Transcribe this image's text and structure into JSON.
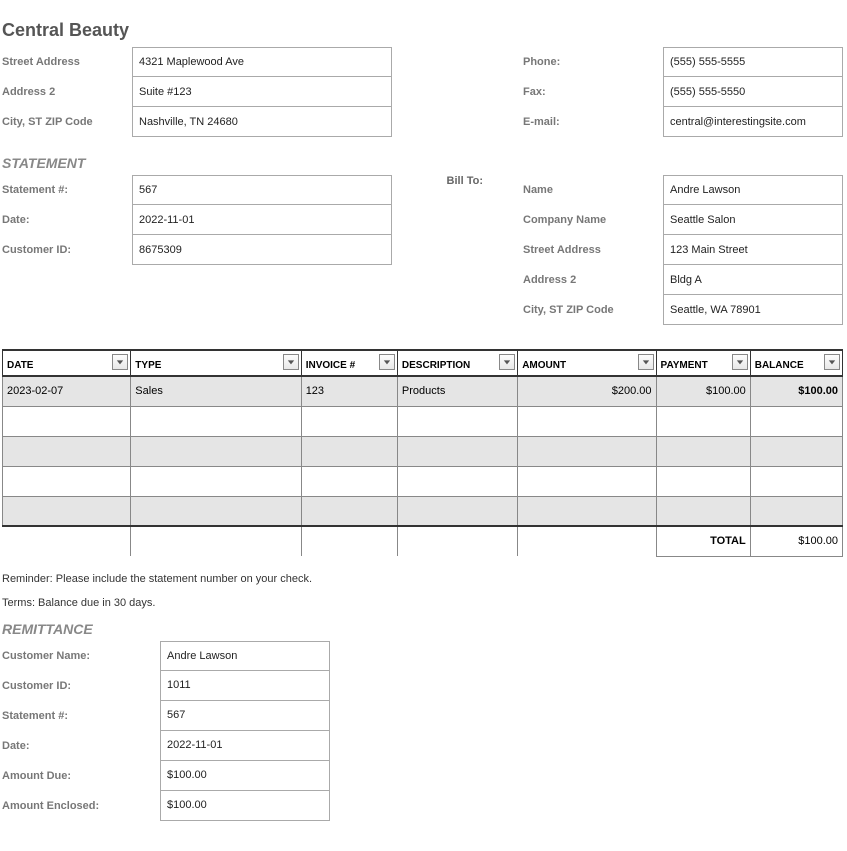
{
  "company_name": "Central Beauty",
  "address_labels": {
    "street": "Street Address",
    "address2": "Address 2",
    "city": "City, ST  ZIP Code"
  },
  "company_address": {
    "street": "4321 Maplewood Ave",
    "address2": "Suite #123",
    "city": "Nashville, TN 24680"
  },
  "contact_labels": {
    "phone": "Phone:",
    "fax": "Fax:",
    "email": "E-mail:"
  },
  "contact": {
    "phone": "(555) 555-5555",
    "fax": "(555) 555-5550",
    "email": "central@interestingsite.com"
  },
  "statement_heading": "STATEMENT",
  "statement_labels": {
    "number": "Statement #:",
    "date": "Date:",
    "customer_id": "Customer ID:"
  },
  "statement": {
    "number": "567",
    "date": "2022-11-01",
    "customer_id": "8675309"
  },
  "billto_heading": "Bill To:",
  "billto_labels": {
    "name": "Name",
    "company": "Company Name",
    "street": "Street Address",
    "address2": "Address 2",
    "city": "City, ST  ZIP Code"
  },
  "billto": {
    "name": "Andre Lawson",
    "company": "Seattle Salon",
    "street": "123 Main Street",
    "address2": "Bldg A",
    "city": "Seattle, WA 78901"
  },
  "columns": {
    "date": "DATE",
    "type": "TYPE",
    "invoice": "INVOICE #",
    "description": "DESCRIPTION",
    "amount": "AMOUNT",
    "payment": "PAYMENT",
    "balance": "BALANCE"
  },
  "rows": [
    {
      "date": "2023-02-07",
      "type": "Sales",
      "invoice": "123",
      "description": "Products",
      "amount": "$200.00",
      "payment": "$100.00",
      "balance": "$100.00"
    }
  ],
  "total_label": "TOTAL",
  "total_value": "$100.00",
  "reminder": "Reminder: Please include the statement number on your check.",
  "terms": "Terms: Balance due in 30 days.",
  "remittance_heading": "REMITTANCE",
  "remit_labels": {
    "customer_name": "Customer Name:",
    "customer_id": "Customer ID:",
    "statement": "Statement #:",
    "date": "Date:",
    "amount_due": "Amount Due:",
    "amount_enclosed": "Amount Enclosed:"
  },
  "remit": {
    "customer_name": "Andre Lawson",
    "customer_id": "1011",
    "statement": "567",
    "date": "2022-11-01",
    "amount_due": "$100.00",
    "amount_enclosed": "$100.00"
  }
}
